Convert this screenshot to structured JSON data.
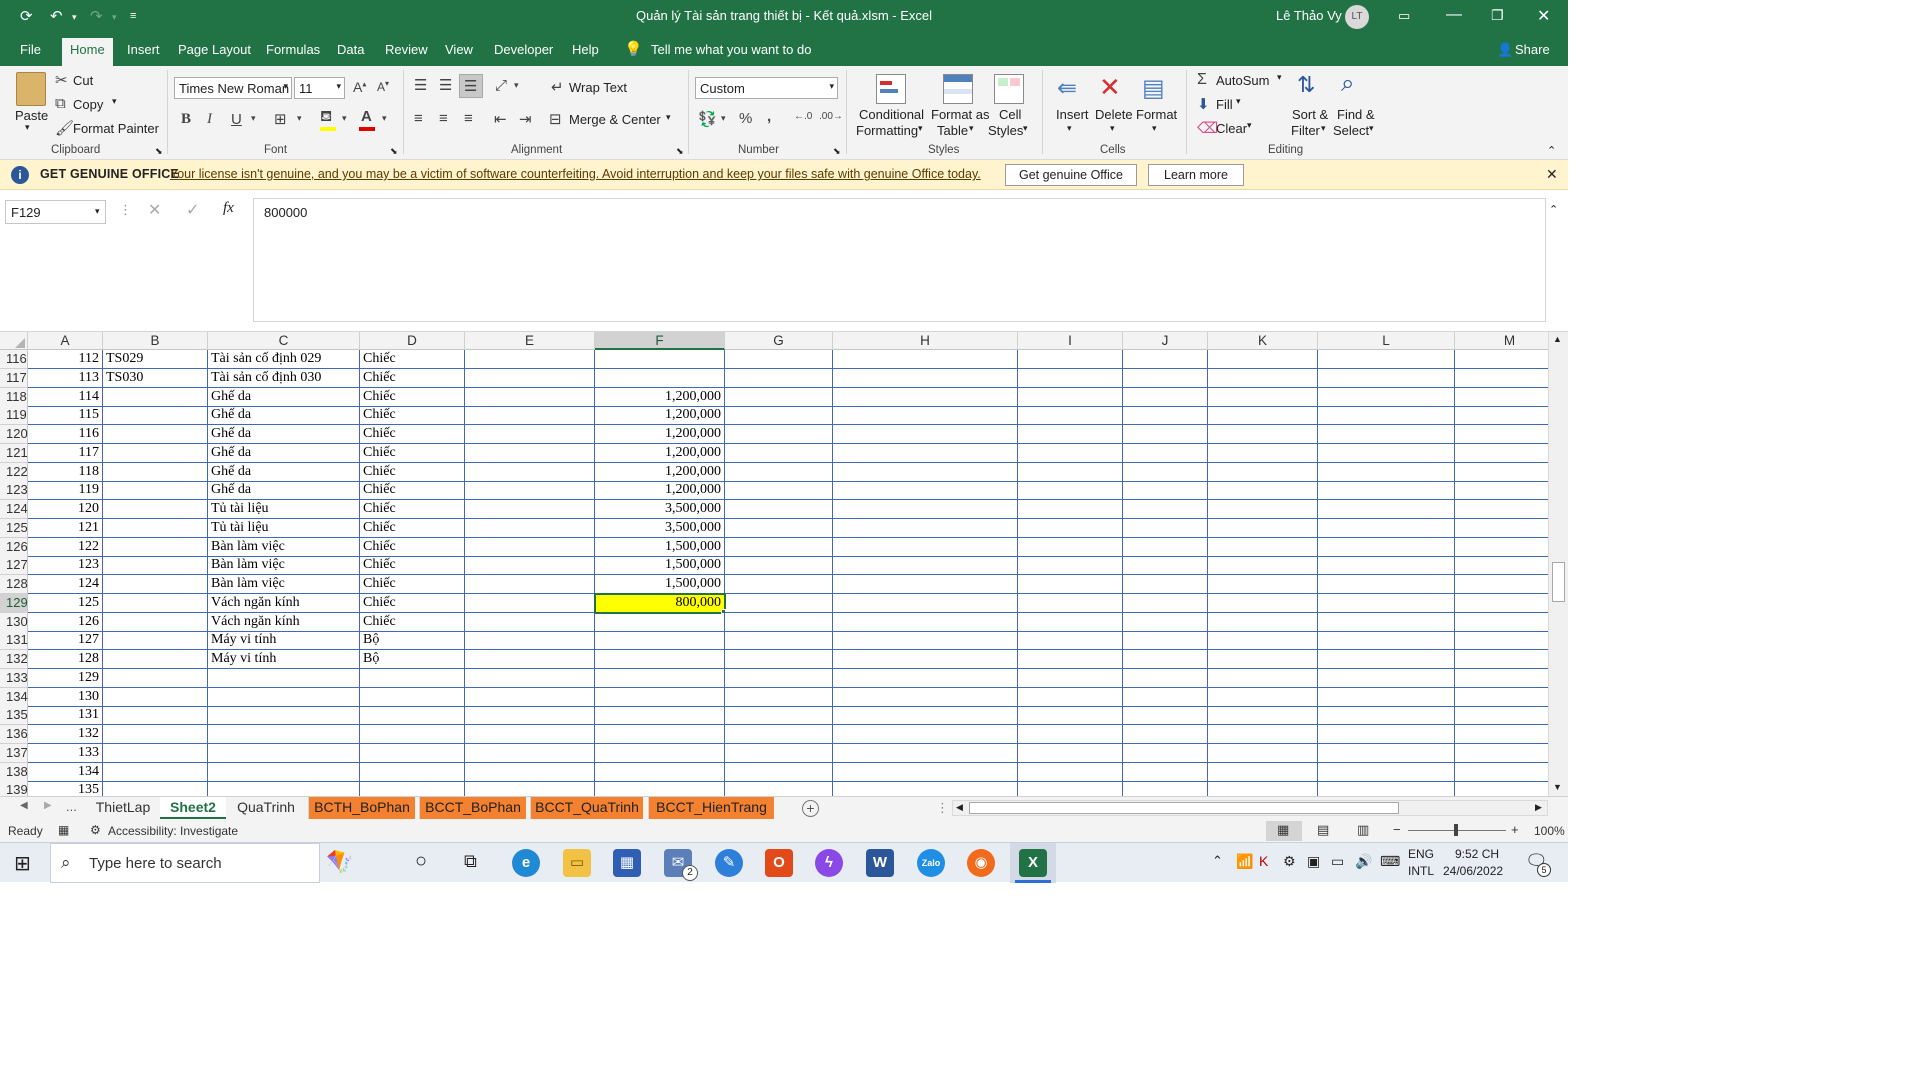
{
  "titlebar": {
    "title": "Quản lý Tài sản trang thiết bị - Kết quả.xlsm  -  Excel",
    "user": "Lê Thảo Vy",
    "initials": "LT"
  },
  "menu": {
    "tabs": [
      "File",
      "Home",
      "Insert",
      "Page Layout",
      "Formulas",
      "Data",
      "Review",
      "View",
      "Developer",
      "Help"
    ],
    "tellme": "Tell me what you want to do",
    "share": "Share"
  },
  "ribbon": {
    "clipboard": {
      "paste": "Paste",
      "cut": "Cut",
      "copy": "Copy",
      "format_painter": "Format Painter",
      "label": "Clipboard"
    },
    "font": {
      "name": "Times New Roman",
      "size": "11",
      "bold": "B",
      "italic": "I",
      "underline": "U",
      "label": "Font"
    },
    "alignment": {
      "wrap": "Wrap Text",
      "merge": "Merge & Center",
      "label": "Alignment"
    },
    "number": {
      "format": "Custom",
      "percent": "%",
      "comma": ",",
      "label": "Number"
    },
    "styles": {
      "conditional": "Conditional",
      "conditional2": "Formatting",
      "format_as": "Format as",
      "format_as2": "Table",
      "cell": "Cell",
      "cell2": "Styles",
      "label": "Styles"
    },
    "cells": {
      "insert": "Insert",
      "delete": "Delete",
      "format": "Format",
      "label": "Cells"
    },
    "editing": {
      "autosum": "AutoSum",
      "fill": "Fill",
      "clear": "Clear",
      "sort": "Sort &",
      "sort2": "Filter",
      "find": "Find &",
      "find2": "Select",
      "label": "Editing"
    }
  },
  "notice": {
    "title": "GET GENUINE OFFICE",
    "message": "Your license isn't genuine, and you may be a victim of software counterfeiting. Avoid interruption and keep your files safe with genuine Office today.",
    "btn1": "Get genuine Office",
    "btn2": "Learn more"
  },
  "formula": {
    "namebox": "F129",
    "value": "800000"
  },
  "columns": [
    "A",
    "B",
    "C",
    "D",
    "E",
    "F",
    "G",
    "H",
    "I",
    "J",
    "K",
    "L",
    "M"
  ],
  "rows": [
    {
      "n": "116",
      "a": "112",
      "b": "TS029",
      "c": "Tài sản cố định 029",
      "d": "Chiếc",
      "f": ""
    },
    {
      "n": "117",
      "a": "113",
      "b": "TS030",
      "c": "Tài sản cố định 030",
      "d": "Chiếc",
      "f": ""
    },
    {
      "n": "118",
      "a": "114",
      "b": "",
      "c": "Ghế da",
      "d": "Chiếc",
      "f": "1,200,000"
    },
    {
      "n": "119",
      "a": "115",
      "b": "",
      "c": "Ghế da",
      "d": "Chiếc",
      "f": "1,200,000"
    },
    {
      "n": "120",
      "a": "116",
      "b": "",
      "c": "Ghế da",
      "d": "Chiếc",
      "f": "1,200,000"
    },
    {
      "n": "121",
      "a": "117",
      "b": "",
      "c": "Ghế da",
      "d": "Chiếc",
      "f": "1,200,000"
    },
    {
      "n": "122",
      "a": "118",
      "b": "",
      "c": "Ghế da",
      "d": "Chiếc",
      "f": "1,200,000"
    },
    {
      "n": "123",
      "a": "119",
      "b": "",
      "c": "Ghế da",
      "d": "Chiếc",
      "f": "1,200,000"
    },
    {
      "n": "124",
      "a": "120",
      "b": "",
      "c": "Tủ tài liệu",
      "d": "Chiếc",
      "f": "3,500,000"
    },
    {
      "n": "125",
      "a": "121",
      "b": "",
      "c": "Tủ tài liệu",
      "d": "Chiếc",
      "f": "3,500,000"
    },
    {
      "n": "126",
      "a": "122",
      "b": "",
      "c": "Bàn làm việc",
      "d": "Chiếc",
      "f": "1,500,000"
    },
    {
      "n": "127",
      "a": "123",
      "b": "",
      "c": "Bàn làm việc",
      "d": "Chiếc",
      "f": "1,500,000"
    },
    {
      "n": "128",
      "a": "124",
      "b": "",
      "c": "Bàn làm việc",
      "d": "Chiếc",
      "f": "1,500,000"
    },
    {
      "n": "129",
      "a": "125",
      "b": "",
      "c": "Vách ngăn kính",
      "d": "Chiếc",
      "f": "800,000"
    },
    {
      "n": "130",
      "a": "126",
      "b": "",
      "c": "Vách ngăn kính",
      "d": "Chiếc",
      "f": ""
    },
    {
      "n": "131",
      "a": "127",
      "b": "",
      "c": "Máy vi tính",
      "d": "Bộ",
      "f": ""
    },
    {
      "n": "132",
      "a": "128",
      "b": "",
      "c": "Máy vi tính",
      "d": "Bộ",
      "f": ""
    },
    {
      "n": "133",
      "a": "129",
      "b": "",
      "c": "",
      "d": "",
      "f": ""
    },
    {
      "n": "134",
      "a": "130",
      "b": "",
      "c": "",
      "d": "",
      "f": ""
    },
    {
      "n": "135",
      "a": "131",
      "b": "",
      "c": "",
      "d": "",
      "f": ""
    },
    {
      "n": "136",
      "a": "132",
      "b": "",
      "c": "",
      "d": "",
      "f": ""
    },
    {
      "n": "137",
      "a": "133",
      "b": "",
      "c": "",
      "d": "",
      "f": ""
    },
    {
      "n": "138",
      "a": "134",
      "b": "",
      "c": "",
      "d": "",
      "f": ""
    },
    {
      "n": "139",
      "a": "135",
      "b": "",
      "c": "",
      "d": "",
      "f": ""
    }
  ],
  "selected_row": "129",
  "sheets": {
    "ellipsis": "...",
    "tabs": [
      {
        "name": "ThietLap",
        "style": "normal"
      },
      {
        "name": "Sheet2",
        "style": "active"
      },
      {
        "name": "QuaTrinh",
        "style": "normal"
      },
      {
        "name": "BCTH_BoPhan",
        "style": "orange"
      },
      {
        "name": "BCCT_BoPhan",
        "style": "orange"
      },
      {
        "name": "BCCT_QuaTrinh",
        "style": "orange"
      },
      {
        "name": "BCCT_HienTrang",
        "style": "orange"
      }
    ]
  },
  "status": {
    "ready": "Ready",
    "accessibility": "Accessibility: Investigate",
    "zoom": "100%"
  },
  "taskbar": {
    "search": "Type here to search",
    "lang1": "ENG",
    "lang2": "INTL",
    "time": "9:52 CH",
    "date": "24/06/2022",
    "notif": "5",
    "mail_badge": "2"
  },
  "colors": {
    "excel_green": "#217346",
    "selection_fill": "#ffff00",
    "orange_tab": "#f4812f",
    "grid_blue": "#3f68b8"
  }
}
